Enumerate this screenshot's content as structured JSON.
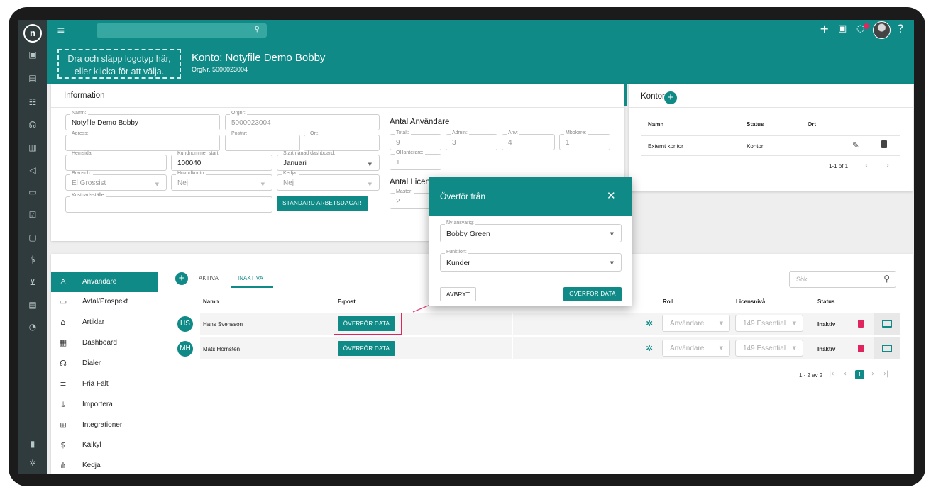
{
  "topbar": {
    "search_icon": "search-icon",
    "icons": [
      "plus-icon",
      "calendar-icon",
      "bell-icon",
      "help-icon"
    ],
    "help_label": "?",
    "notification_badge": "1"
  },
  "header": {
    "dropzone_line1": "Dra och släpp logotyp här,",
    "dropzone_line2": "eller klicka för att välja.",
    "account_title": "Konto: Notyfile Demo Bobby",
    "org_number": "OrgNr. 5000023004"
  },
  "info": {
    "title": "Information",
    "name_label": "Namn:",
    "name_value": "Notyfile Demo Bobby",
    "orgnr_label": "Orgnr:",
    "orgnr_value": "5000023004",
    "address_label": "Adress:",
    "postnr_label": "Postnr:",
    "ort_label": "Ort:",
    "homepage_label": "Hemsida:",
    "custno_label": "Kundnummer start:",
    "custno_value": "100040",
    "startmonth_label": "Startmånad dashboard:",
    "startmonth_value": "Januari",
    "branch_label": "Bransch:",
    "branch_value": "El Grossist",
    "mainaccount_label": "Huvudkonto:",
    "mainaccount_value": "Nej",
    "chain_label": "Kedja:",
    "chain_value": "Nej",
    "costcenter_label": "Kostnadsställe:",
    "workdays_button": "STANDARD ARBETSDAGAR",
    "users_heading": "Antal Användare",
    "total_label": "Totalt:",
    "total_value": "9",
    "admin_label": "Admin:",
    "admin_value": "3",
    "anv_label": "Anv:",
    "anv_value": "4",
    "mbokare_label": "Mbokare:",
    "mbokare_value": "1",
    "ohanterare_label": "OHanterare:",
    "ohanterare_value": "1",
    "licenses_heading": "Antal Licenc",
    "master_label": "Master:",
    "master_value": "2"
  },
  "offices": {
    "title": "Kontor",
    "headers": [
      "Namn",
      "Status",
      "Ort"
    ],
    "rows": [
      {
        "name": "Externt kontor",
        "status": "Kontor",
        "ort": ""
      }
    ],
    "pagination": "1-1 of 1"
  },
  "sidebar": {
    "items": [
      {
        "label": "Användare",
        "icon": "user-icon",
        "glyph": "♙"
      },
      {
        "label": "Avtal/Prospekt",
        "icon": "monitor-icon",
        "glyph": "▭"
      },
      {
        "label": "Artiklar",
        "icon": "shapes-icon",
        "glyph": "⌂"
      },
      {
        "label": "Dashboard",
        "icon": "dashboard-icon",
        "glyph": "▦"
      },
      {
        "label": "Dialer",
        "icon": "headset-icon",
        "glyph": "☊"
      },
      {
        "label": "Fria Fält",
        "icon": "lines-icon",
        "glyph": "≡"
      },
      {
        "label": "Importera",
        "icon": "import-icon",
        "glyph": "⤓"
      },
      {
        "label": "Integrationer",
        "icon": "integration-icon",
        "glyph": "⊞"
      },
      {
        "label": "Kalkyl",
        "icon": "dollar-icon",
        "glyph": "$"
      },
      {
        "label": "Kedja",
        "icon": "chain-icon",
        "glyph": "⋔"
      }
    ]
  },
  "users": {
    "tab_active": "AKTIVA",
    "tab_inactive": "INAKTIVA",
    "search_placeholder": "Sök",
    "headers": {
      "name": "Namn",
      "email": "E-post",
      "role": "Roll",
      "license": "Licensnivå",
      "status": "Status"
    },
    "rows": [
      {
        "initials": "HS",
        "name": "Hans Svensson",
        "transfer": "ÖVERFÖR DATA",
        "role": "Användare",
        "license": "149 Essential",
        "status": "Inaktiv"
      },
      {
        "initials": "MH",
        "name": "Mats Hörnsten",
        "transfer": "ÖVERFÖR DATA",
        "role": "Användare",
        "license": "149 Essential",
        "status": "Inaktiv"
      }
    ],
    "pagination": "1 - 2 av 2",
    "current_page": "1"
  },
  "modal": {
    "title": "Överför från",
    "responsible_label": "Ny ansvarig:",
    "responsible_value": "Bobby Green",
    "function_label": "Funktion:",
    "function_value": "Kunder",
    "cancel": "AVBRYT",
    "confirm": "ÖVERFÖR DATA"
  },
  "colors": {
    "accent": "#0f8a86",
    "danger": "#e0245e"
  }
}
